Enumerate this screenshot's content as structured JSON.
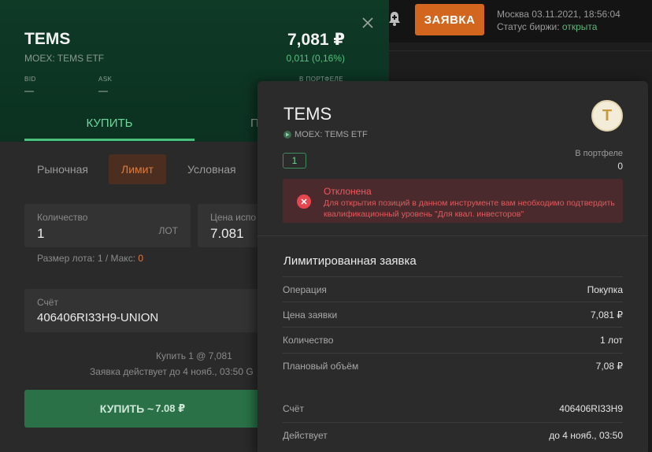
{
  "topbar": {
    "order_button": "ЗАЯВКА",
    "market_time": "Москва 03.11.2021, 18:56:04",
    "status_label": "Статус биржи: ",
    "status_value": "открыта"
  },
  "instrument": {
    "ticker": "TEMS",
    "exchange_name": "MOEX: TEMS ETF",
    "price": "7,081 ₽",
    "change": "0,011 (0,16%)",
    "bid_label": "BID",
    "bid_value": "—",
    "ask_label": "ASK",
    "ask_value": "—",
    "portfolio_label": "В ПОРТФЕЛЕ"
  },
  "tabs": {
    "buy": "КУПИТЬ",
    "sell": "П"
  },
  "order_types": [
    "Рыночная",
    "Лимит",
    "Условная"
  ],
  "form": {
    "quantity_label": "Количество",
    "quantity_value": "1",
    "quantity_unit": "ЛОТ",
    "price_label": "Цена испо",
    "price_value": "7.081",
    "lot_info": "Размер лота: 1 / Макс: ",
    "lot_max": "0",
    "account_label": "Счёт",
    "account_value": "406406RI33H9-UNION"
  },
  "summary": {
    "line1": "Купить 1 @ 7,081",
    "line2": "Заявка действует до 4 нояб., 03:50 G"
  },
  "buy_button": {
    "label": "КУПИТЬ ~",
    "amount": "7.08 ₽"
  },
  "modal": {
    "ticker": "TEMS",
    "exchange_name": "MOEX: TEMS ETF",
    "logo_letter": "T",
    "badge": "1",
    "portfolio_label": "В портфеле",
    "portfolio_value": "0",
    "alert_title": "Отклонена",
    "alert_text": "Для открытия позиций в данном инструменте вам необходимо подтвердить квалификационный уровень \"Для квал. инвесторов\"",
    "section_title": "Лимитированная заявка",
    "rows": [
      {
        "key": "Операция",
        "value": "Покупка"
      },
      {
        "key": "Цена заявки",
        "value": "7,081 ₽"
      },
      {
        "key": "Количество",
        "value": "1 лот"
      },
      {
        "key": "Плановый объём",
        "value": "7,08 ₽"
      }
    ],
    "rows2": [
      {
        "key": "Счёт",
        "value": "406406RI33H9"
      },
      {
        "key": "Действует",
        "value": "до 4 нояб., 03:50"
      }
    ]
  }
}
